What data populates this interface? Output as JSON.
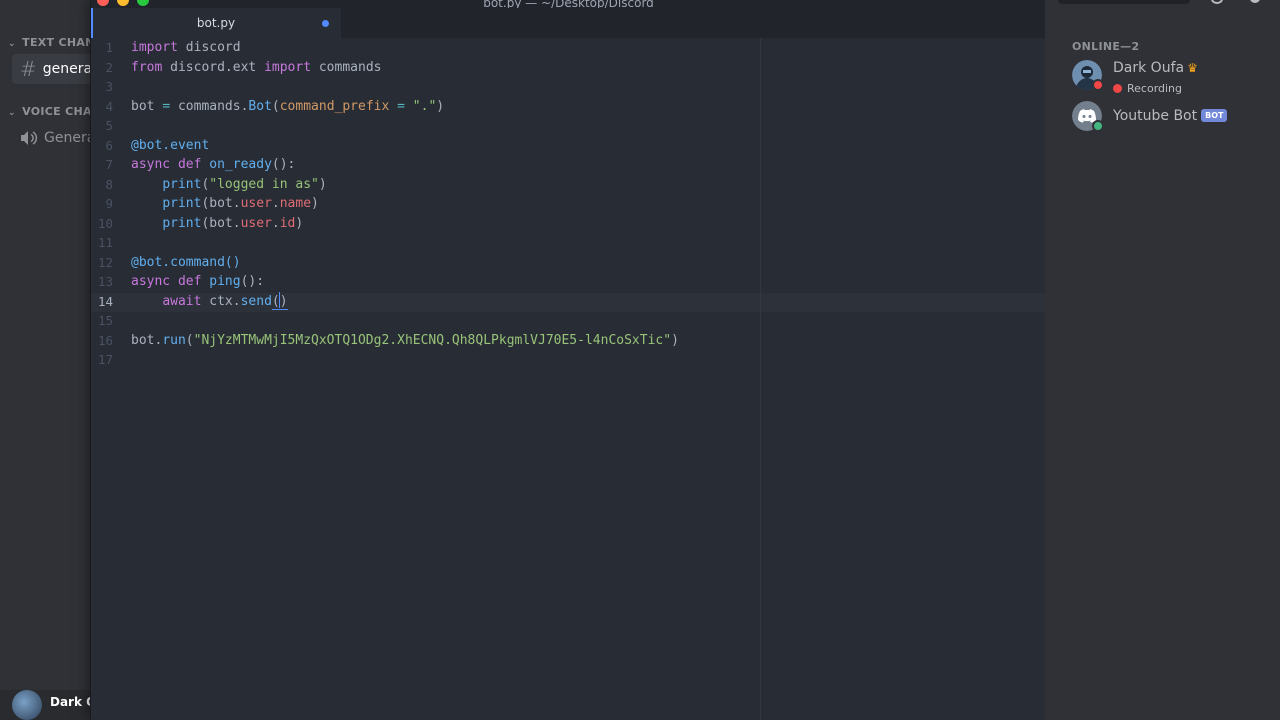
{
  "sidebar": {
    "categories": [
      {
        "label": "TEXT CHANNELS",
        "channels": [
          {
            "label": "general"
          }
        ]
      },
      {
        "label": "VOICE CHANNELS",
        "channels": [
          {
            "label": "General"
          }
        ]
      }
    ],
    "user": {
      "name": "Dark Oufa"
    }
  },
  "editor": {
    "window_title": "bot.py — ~/Desktop/Discord",
    "tab": {
      "label": "bot.py",
      "modified": true
    },
    "cursor_line": 14,
    "lines": [
      [
        {
          "t": "import",
          "c": "kw"
        },
        {
          "t": " discord",
          "c": "plain"
        }
      ],
      [
        {
          "t": "from",
          "c": "kw"
        },
        {
          "t": " discord.ext ",
          "c": "plain"
        },
        {
          "t": "import",
          "c": "kw"
        },
        {
          "t": " commands",
          "c": "plain"
        }
      ],
      [],
      [
        {
          "t": "bot ",
          "c": "plain"
        },
        {
          "t": "=",
          "c": "op"
        },
        {
          "t": " commands.",
          "c": "plain"
        },
        {
          "t": "Bot",
          "c": "fn"
        },
        {
          "t": "(",
          "c": "plain"
        },
        {
          "t": "command_prefix",
          "c": "prm"
        },
        {
          "t": " ",
          "c": "plain"
        },
        {
          "t": "=",
          "c": "op"
        },
        {
          "t": " ",
          "c": "plain"
        },
        {
          "t": "\".\"",
          "c": "str"
        },
        {
          "t": ")",
          "c": "plain"
        }
      ],
      [],
      [
        {
          "t": "@bot.event",
          "c": "dec"
        }
      ],
      [
        {
          "t": "async",
          "c": "kw"
        },
        {
          "t": " ",
          "c": "plain"
        },
        {
          "t": "def",
          "c": "kw"
        },
        {
          "t": " ",
          "c": "plain"
        },
        {
          "t": "on_ready",
          "c": "fn"
        },
        {
          "t": "():",
          "c": "plain"
        }
      ],
      [
        {
          "t": "    ",
          "c": "plain"
        },
        {
          "t": "print",
          "c": "fn"
        },
        {
          "t": "(",
          "c": "plain"
        },
        {
          "t": "\"logged in as\"",
          "c": "str"
        },
        {
          "t": ")",
          "c": "plain"
        }
      ],
      [
        {
          "t": "    ",
          "c": "plain"
        },
        {
          "t": "print",
          "c": "fn"
        },
        {
          "t": "(bot.",
          "c": "plain"
        },
        {
          "t": "user",
          "c": "prop"
        },
        {
          "t": ".",
          "c": "plain"
        },
        {
          "t": "name",
          "c": "prop"
        },
        {
          "t": ")",
          "c": "plain"
        }
      ],
      [
        {
          "t": "    ",
          "c": "plain"
        },
        {
          "t": "print",
          "c": "fn"
        },
        {
          "t": "(bot.",
          "c": "plain"
        },
        {
          "t": "user",
          "c": "prop"
        },
        {
          "t": ".",
          "c": "plain"
        },
        {
          "t": "id",
          "c": "prop"
        },
        {
          "t": ")",
          "c": "plain"
        }
      ],
      [],
      [
        {
          "t": "@bot.command()",
          "c": "dec"
        }
      ],
      [
        {
          "t": "async",
          "c": "kw"
        },
        {
          "t": " ",
          "c": "plain"
        },
        {
          "t": "def",
          "c": "kw"
        },
        {
          "t": " ",
          "c": "plain"
        },
        {
          "t": "ping",
          "c": "fn"
        },
        {
          "t": "():",
          "c": "plain"
        }
      ],
      [
        {
          "t": "    ",
          "c": "plain"
        },
        {
          "t": "await",
          "c": "kw"
        },
        {
          "t": " ctx.",
          "c": "plain"
        },
        {
          "t": "send",
          "c": "fn"
        },
        {
          "t": "(",
          "c": "plain ul"
        },
        {
          "t": "",
          "c": "caret"
        },
        {
          "t": ")",
          "c": "plain ul"
        }
      ],
      [],
      [
        {
          "t": "bot.",
          "c": "plain"
        },
        {
          "t": "run",
          "c": "fn"
        },
        {
          "t": "(",
          "c": "plain"
        },
        {
          "t": "\"NjYzMTMwMjI5MzQxOTQ1ODg2.XhECNQ.Qh8QLPkgmlVJ70E5-l4nCoSxTic\"",
          "c": "str"
        },
        {
          "t": ")",
          "c": "plain"
        }
      ],
      []
    ]
  },
  "members": {
    "header": "ONLINE—2",
    "list": [
      {
        "name": "Dark Oufa",
        "activity": "Recording",
        "status": "dnd",
        "name_color": "#b9bbbe",
        "owner": true
      },
      {
        "name": "Youtube Bot",
        "tag": "BOT",
        "status": "online",
        "name_color": "#b9bbbe"
      }
    ]
  },
  "colors": {
    "accent": "#528bff",
    "online": "#43b581",
    "dnd": "#f04747",
    "bot_tag": "#7289da",
    "crown": "#faa61a"
  }
}
